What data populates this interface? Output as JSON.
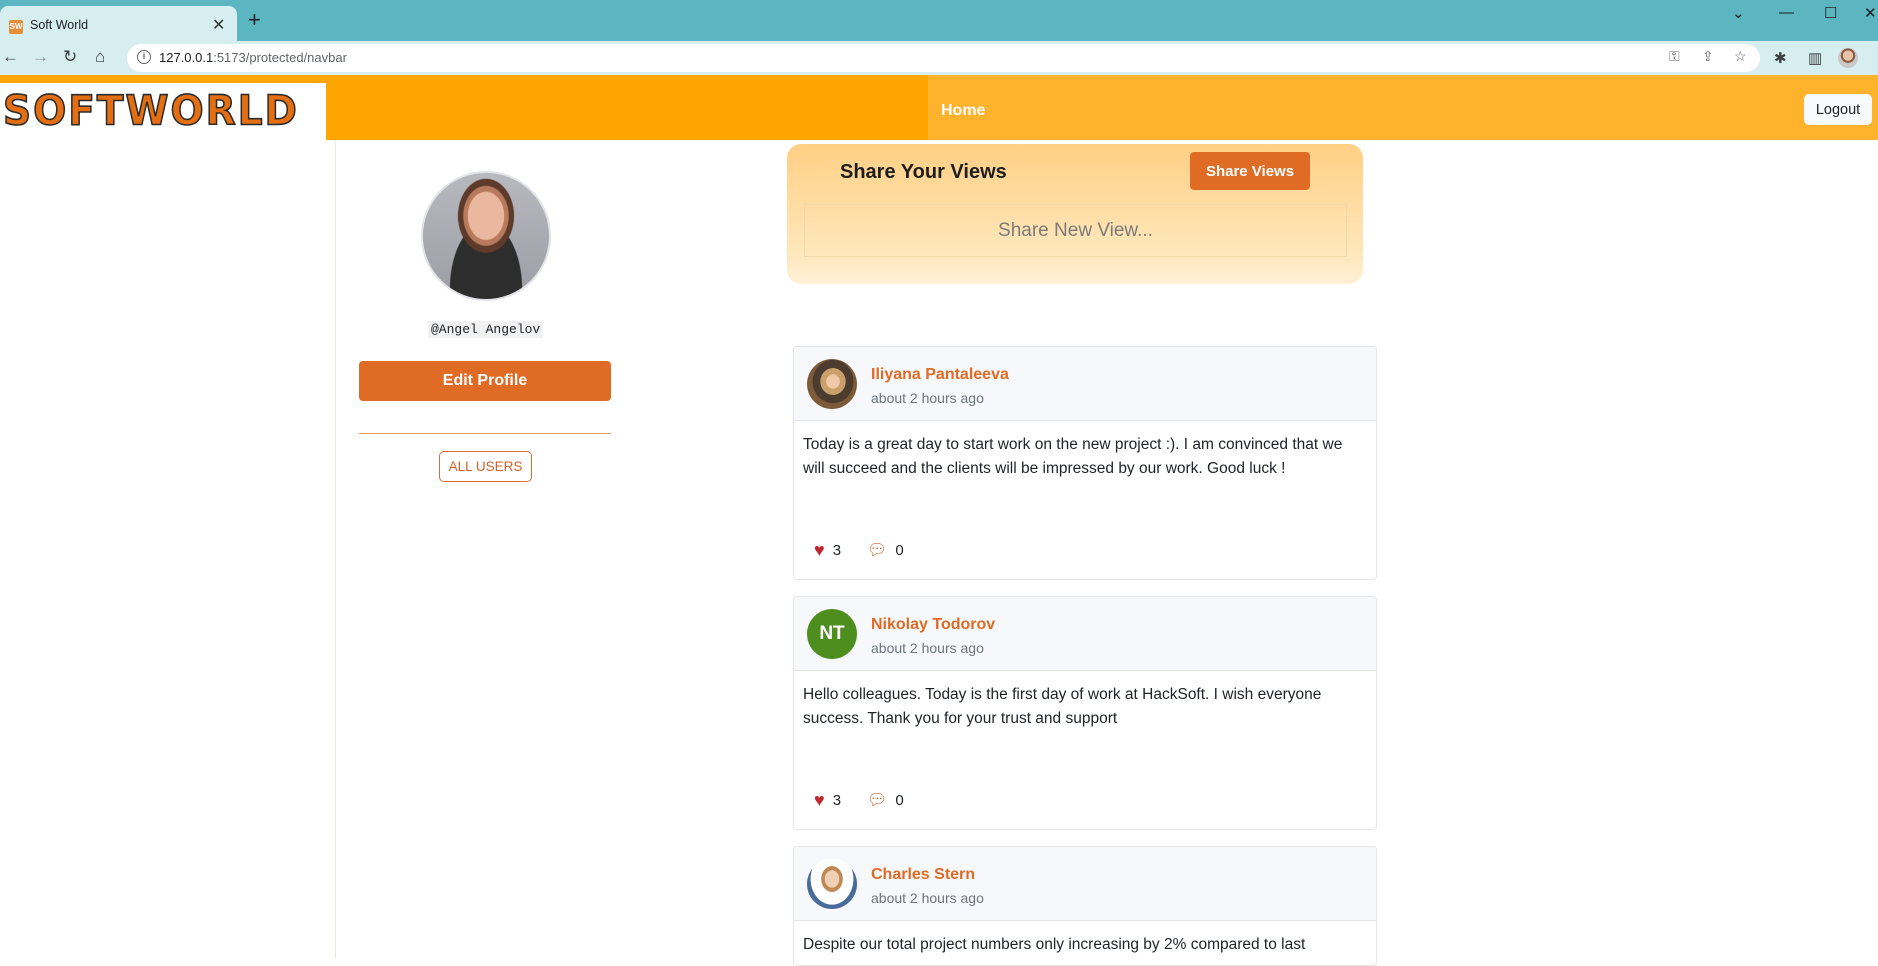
{
  "browser": {
    "tab_title": "Soft World",
    "tab_favicon": "SW",
    "url_host": "127.0.0.1",
    "url_path": ":5173/protected/navbar"
  },
  "navbar": {
    "logo_text": "SOFTWORLD",
    "home_label": "Home",
    "logout_label": "Logout"
  },
  "profile": {
    "username": "@Angel Angelov",
    "edit_label": "Edit Profile",
    "all_users_label": "ALL USERS"
  },
  "share": {
    "title": "Share Your Views",
    "button_label": "Share Views",
    "placeholder": "Share New View..."
  },
  "posts": [
    {
      "author": "Iliyana Pantaleeva",
      "time": "about 2 hours ago",
      "text": "Today is a great day to start work on the new project :). I am convinced that we will succeed and the clients will be impressed by our work. Good luck !",
      "likes": "3",
      "comments": "0"
    },
    {
      "author": "Nikolay Todorov",
      "initials": "NT",
      "time": "about 2 hours ago",
      "text": "Hello colleagues. Today is the first day of work at HackSoft. I wish everyone success. Thank you for your trust and support",
      "likes": "3",
      "comments": "0"
    },
    {
      "author": "Charles Stern",
      "time": "about 2 hours ago",
      "text": "Despite our total project numbers only increasing by 2% compared to last"
    }
  ],
  "colors": {
    "accent": "#e06b24",
    "navbar": "#ffa500",
    "like": "#c0272d"
  }
}
